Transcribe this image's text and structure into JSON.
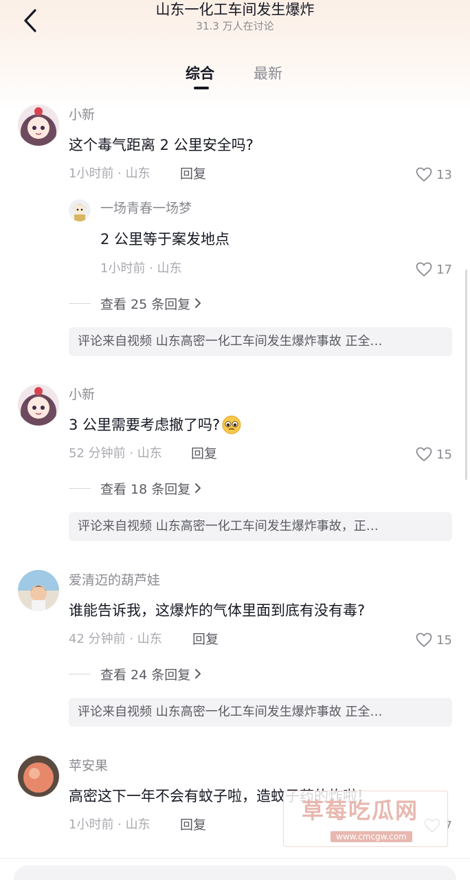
{
  "header": {
    "title": "山东一化工车间发生爆炸",
    "subtitle": "31.3 万人在讨论"
  },
  "tabs": [
    {
      "label": "综合",
      "active": true
    },
    {
      "label": "最新",
      "active": false
    }
  ],
  "comments": [
    {
      "username": "小新",
      "content": "这个毒气距离 2 公里安全吗?",
      "meta": "1小时前 · 山东",
      "reply_label": "回复",
      "likes": "13",
      "top_reply": {
        "username": "一场青春一场梦",
        "content": "2 公里等于案发地点",
        "meta": "1小时前 · 山东",
        "likes": "17"
      },
      "view_replies": "查看 25 条回复",
      "source": "评论来自视频 山东高密一化工车间发生爆炸事故 正全…"
    },
    {
      "username": "小新",
      "content": "3 公里需要考虑撤了吗?",
      "meta": "52 分钟前 · 山东",
      "reply_label": "回复",
      "likes": "15",
      "view_replies": "查看 18 条回复",
      "source": "评论来自视频 山东高密一化工车间发生爆炸事故，正…"
    },
    {
      "username": "爱清迈的葫芦娃",
      "content": "谁能告诉我，这爆炸的气体里面到底有没有毒?",
      "meta": "42 分钟前 · 山东",
      "reply_label": "回复",
      "likes": "15",
      "view_replies": "查看 24 条回复",
      "source": "评论来自视频 山东高密一化工车间发生爆炸事故 正全…"
    },
    {
      "username": "苹安果",
      "content": "高密这下一年不会有蚊子啦，造蚊子药的炸啦!",
      "meta": "1小时前 · 山东",
      "reply_label": "回复",
      "likes": "7"
    }
  ],
  "watermark": {
    "title": "草莓吃瓜网",
    "url": "www.cmcgw.com"
  },
  "colors": {
    "text_primary": "#161823",
    "text_secondary": "#8a8b91",
    "source_bg": "#f3f3f5",
    "header_tint": "#fbefe6"
  },
  "icons": {
    "back": "chevron-left-icon",
    "like": "heart-outline-icon",
    "chevron": "chevron-right-icon",
    "emoji": "pleading-face-emoji-icon"
  }
}
